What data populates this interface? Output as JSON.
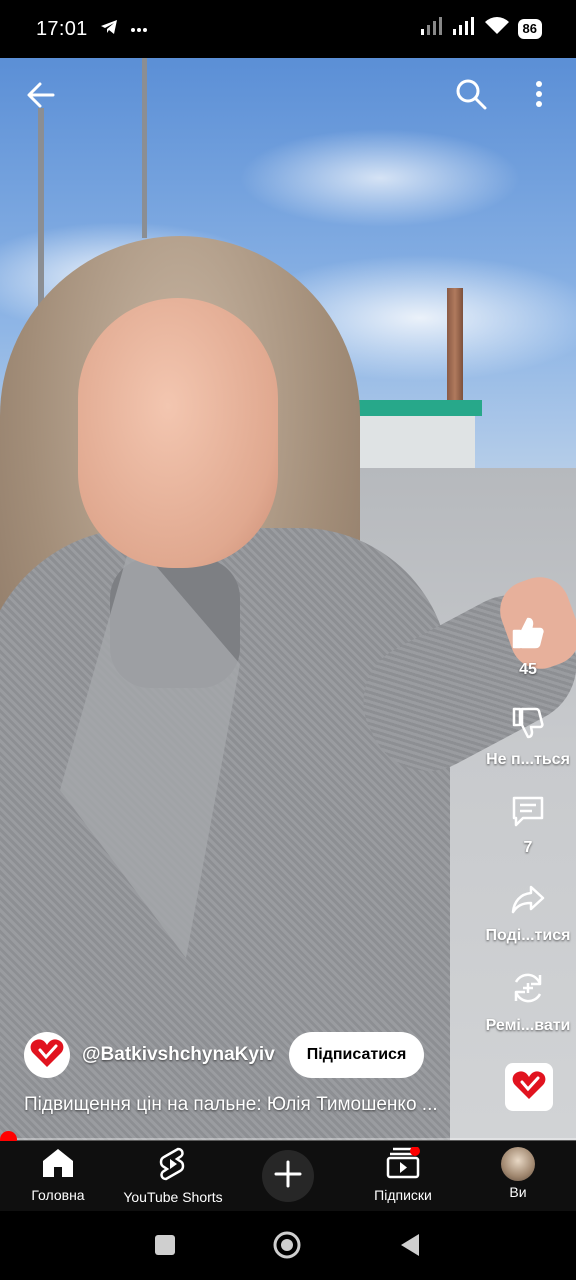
{
  "status_bar": {
    "time": "17:01",
    "notifications": [
      "telegram-icon",
      "more-dots-icon"
    ],
    "battery": "86",
    "signal_icons": [
      "signal-icon",
      "signal-icon",
      "wifi-icon"
    ]
  },
  "top_bar": {
    "back_icon": "arrow-left-icon",
    "search_icon": "search-icon",
    "menu_icon": "vertical-dots-icon"
  },
  "actions": {
    "like": {
      "icon": "thumbs-up-icon",
      "label": "45"
    },
    "dislike": {
      "icon": "thumbs-down-icon",
      "label": "Не п...ться"
    },
    "comments": {
      "icon": "comment-icon",
      "label": "7"
    },
    "share": {
      "icon": "share-icon",
      "label": "Поді...тися"
    },
    "remix": {
      "icon": "remix-icon",
      "label": "Ремі...вати"
    }
  },
  "channel": {
    "name": "@BatkivshchynaKyiv",
    "subscribe_label": "Підписатися"
  },
  "video": {
    "title": "Підвищення цін на пальне: Юлія Тимошенко ...",
    "progress": 0.01
  },
  "bottom_nav": {
    "items": [
      {
        "label": "Головна",
        "icon": "home-icon"
      },
      {
        "label": "YouTube Shorts",
        "icon": "shorts-icon"
      },
      {
        "label": "",
        "icon": "plus-icon"
      },
      {
        "label": "Підписки",
        "icon": "subscriptions-icon"
      },
      {
        "label": "Ви",
        "icon": "avatar"
      }
    ]
  },
  "colors": {
    "accent": "#ff0000",
    "brand_heart": "#e1131f",
    "nav_bg": "#0f0f0f"
  }
}
